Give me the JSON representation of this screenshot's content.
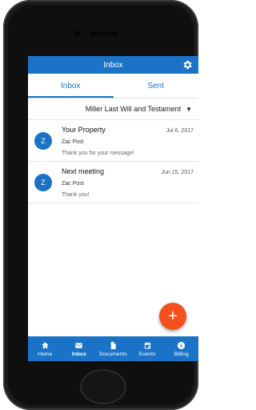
{
  "appbar": {
    "title": "Inbox",
    "settings_icon": "gear-icon"
  },
  "tabs": [
    {
      "label": "Inbox",
      "active": true
    },
    {
      "label": "Sent",
      "active": false
    }
  ],
  "filter": {
    "selected": "Miller Last Will and Testament",
    "icon": "caret-down-icon"
  },
  "messages": [
    {
      "avatar": "Z",
      "subject": "Your Property",
      "date": "Jul 6, 2017",
      "sender": "Zac Post",
      "preview": "Thank you for your message!"
    },
    {
      "avatar": "Z",
      "subject": "Next meeting",
      "date": "Jun 15, 2017",
      "sender": "Zac Post",
      "preview": "Thank you!"
    }
  ],
  "fab": {
    "symbol": "+"
  },
  "bottom_nav": [
    {
      "label": "Home",
      "icon": "home-icon"
    },
    {
      "label": "Inbox",
      "icon": "mail-icon",
      "active": true
    },
    {
      "label": "Documents",
      "icon": "document-icon"
    },
    {
      "label": "Events",
      "icon": "calendar-icon"
    },
    {
      "label": "Billing",
      "icon": "dollar-icon"
    }
  ],
  "colors": {
    "primary": "#1a73c6",
    "fab": "#f4511e"
  }
}
